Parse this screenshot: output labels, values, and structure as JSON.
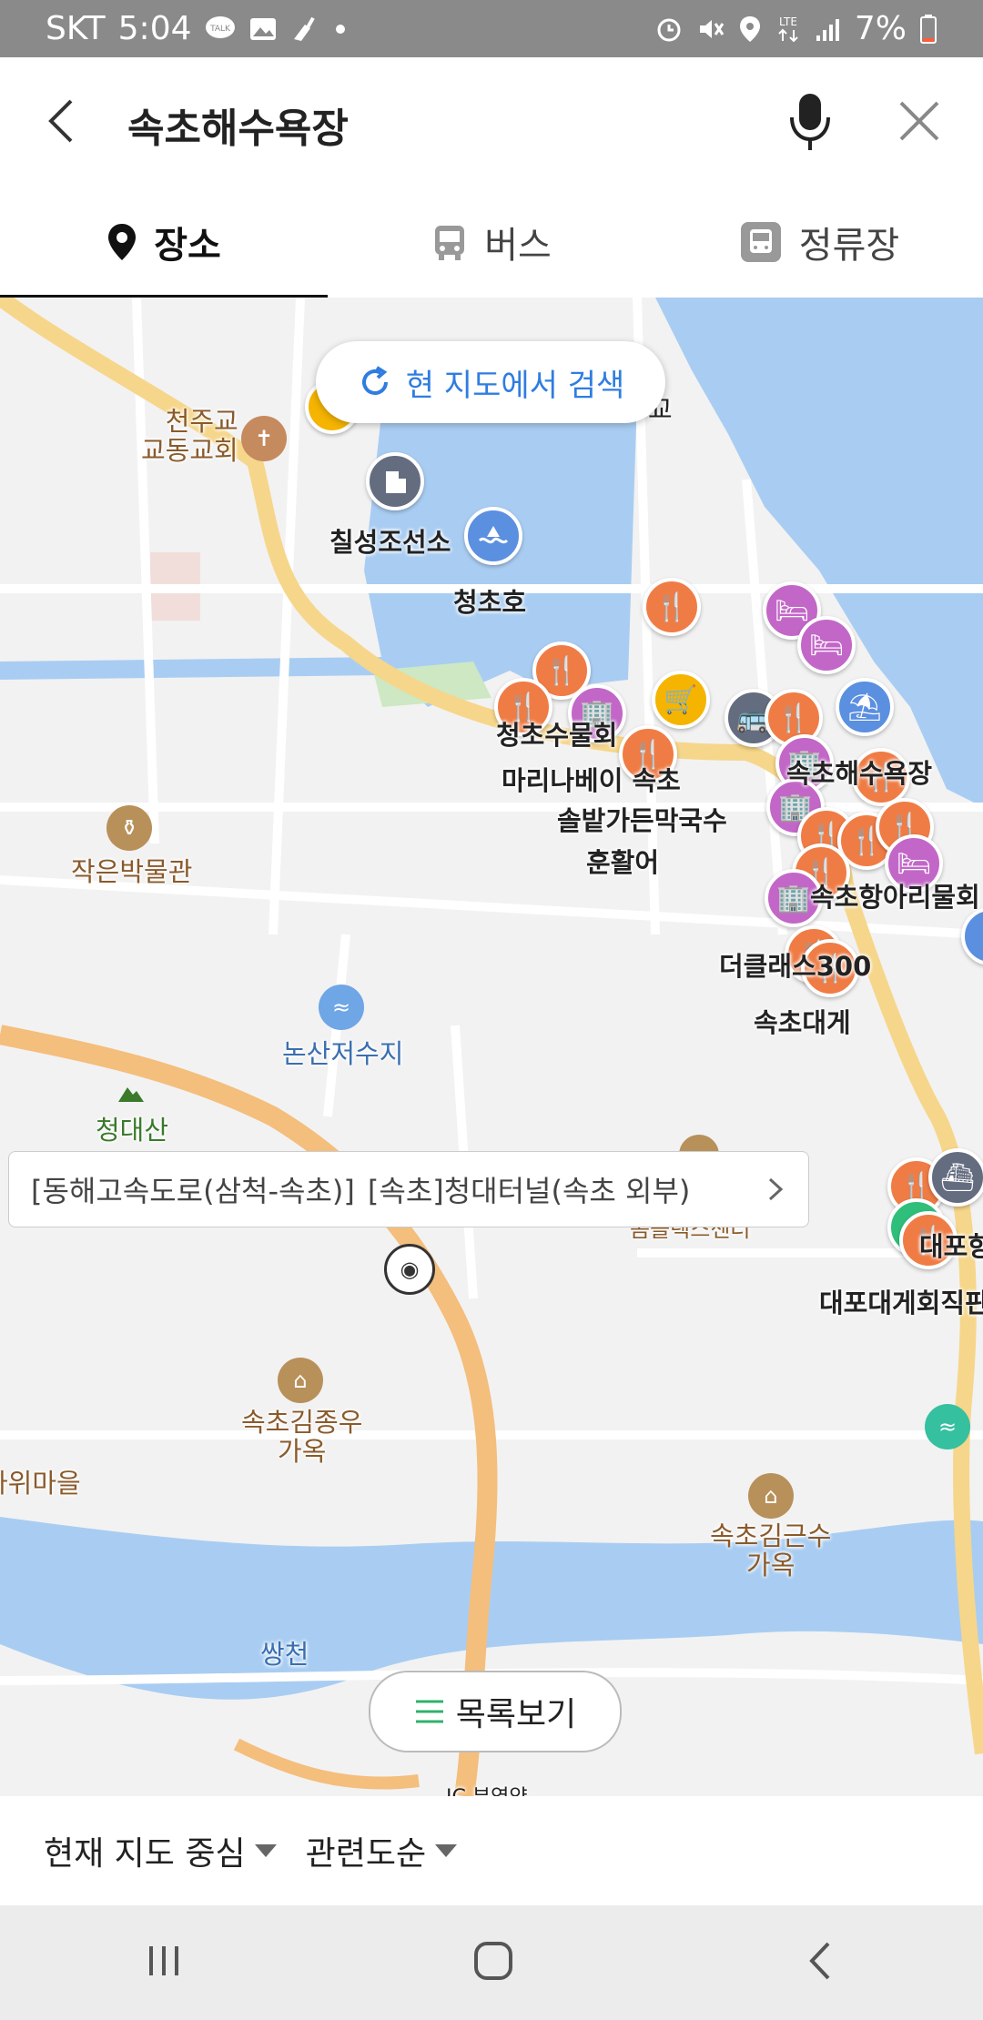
{
  "status": {
    "carrier": "SKT",
    "time": "5:04",
    "battery": "7%",
    "icons_left": [
      "talk-icon",
      "gallery-icon",
      "clean-icon",
      "dot-icon"
    ],
    "icons_right": [
      "alarm-icon",
      "mute-icon",
      "location-icon",
      "lte-icon",
      "signal-icon",
      "battery-icon"
    ]
  },
  "search": {
    "query": "속초해수욕장"
  },
  "tabs": [
    {
      "label": "장소",
      "icon": "place-pin-icon",
      "active": true
    },
    {
      "label": "버스",
      "icon": "bus-icon",
      "active": false
    },
    {
      "label": "정류장",
      "icon": "bus-stop-icon",
      "active": false
    }
  ],
  "map": {
    "search_here": "현 지도에서 검색",
    "labels": {
      "church": "천주교\n교동교회",
      "shipyard": "칠성조선소",
      "lake": "청초호",
      "restaurant1": "청초수물회",
      "hotel1": "마리나베이 속초",
      "restaurant2": "솔밭가든막국수",
      "restaurant3": "훈활어",
      "beach": "속초해수욕장",
      "aquarium": "속초항아리물회",
      "museum": "작은박물관",
      "theclass": "더클래스300",
      "crab": "속초대게",
      "reservoir": "논산저수지",
      "mountain": "청대산",
      "house1": "속초김종우\n가옥",
      "village": "바위마을",
      "house2": "속초김근수\n가옥",
      "river": "쌍천",
      "daepo": "대포항",
      "daepo_crab": "대포대게회직판",
      "partial_top": "교",
      "ic": "IC 부영양",
      "center": "콤플렉스센터"
    },
    "cctv": {
      "road": "[동해고속도로(삼척-속초)]",
      "name": "[속초]청대터널(속초 외부)"
    }
  },
  "list_button": "목록보기",
  "filters": [
    {
      "label": "현재 지도 중심"
    },
    {
      "label": "관련도순"
    }
  ],
  "colors": {
    "accent_blue": "#2f7de1",
    "road_yellow": "#f6d68a",
    "water": "#a9cdf2",
    "marker_orange": "#f07c45",
    "marker_purple": "#c267c7"
  }
}
